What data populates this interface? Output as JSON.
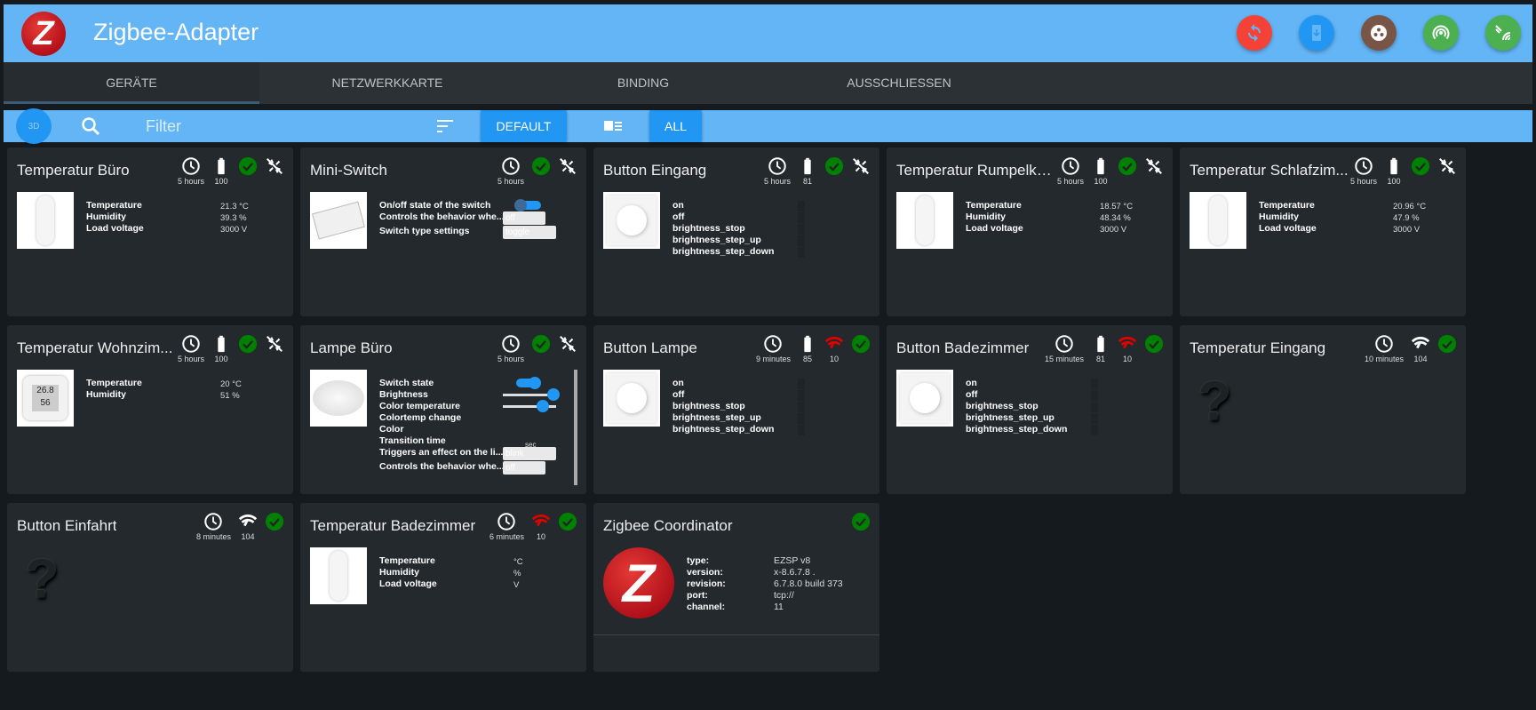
{
  "header": {
    "title": "Zigbee-Adapter",
    "logo_text": "Z",
    "buttons": [
      {
        "name": "refresh-button",
        "icon": "refresh-icon",
        "color": "#f44336"
      },
      {
        "name": "install-button",
        "icon": "phone-download-icon",
        "color": "#2196f3"
      },
      {
        "name": "groups-button",
        "icon": "group-icon",
        "color": "#795548"
      },
      {
        "name": "pairing-button",
        "icon": "pairing-icon",
        "color": "#4caf50"
      },
      {
        "name": "touchlink-button",
        "icon": "touchlink-icon",
        "color": "#4caf50"
      }
    ]
  },
  "tabs": [
    {
      "label": "GERÄTE",
      "active": true
    },
    {
      "label": "NETZWERKKARTE"
    },
    {
      "label": "BINDING"
    },
    {
      "label": "AUSSCHLIESSEN"
    }
  ],
  "toolbar": {
    "btn3d": "3D",
    "filter_placeholder": "Filter",
    "default_label": "DEFAULT",
    "all_label": "ALL"
  },
  "cards": [
    {
      "title": "Temperatur Büro",
      "time": "5 hours",
      "battery": "100",
      "link_off": true,
      "img": "sensor",
      "rows": [
        "Temperature",
        "Humidity",
        "Load voltage"
      ],
      "values": [
        "21.3 °C",
        "39.3 %",
        "3000 V"
      ]
    },
    {
      "title": "Mini-Switch",
      "time": "5 hours",
      "link_off": true,
      "img": "switch",
      "controls": [
        {
          "label": "On/off state of the switch",
          "type": "toggle"
        },
        {
          "label": "Controls the behavior whe...",
          "type": "select",
          "value": "off"
        },
        {
          "label": "Switch type settings",
          "type": "select",
          "value": "toggle"
        }
      ]
    },
    {
      "title": "Button Eingang",
      "time": "5 hours",
      "battery": "81",
      "link_off": true,
      "img": "button",
      "rows": [
        "on",
        "off",
        "brightness_stop",
        "brightness_step_up",
        "brightness_step_down"
      ],
      "states": true
    },
    {
      "title": "Temperatur Rumpelka...",
      "time": "5 hours",
      "battery": "100",
      "link_off": true,
      "img": "sensor",
      "rows": [
        "Temperature",
        "Humidity",
        "Load voltage"
      ],
      "values": [
        "18.57 °C",
        "48.34 %",
        "3000 V"
      ]
    },
    {
      "title": "Temperatur Schlafzim...",
      "time": "5 hours",
      "battery": "100",
      "link_off": true,
      "img": "sensor",
      "rows": [
        "Temperature",
        "Humidity",
        "Load voltage"
      ],
      "values": [
        "20.96 °C",
        "47.9 %",
        "3000 V"
      ]
    },
    {
      "title": "Temperatur Wohnzim...",
      "time": "5 hours",
      "battery": "100",
      "link_off": true,
      "img": "lcd",
      "lcd": [
        "26.8",
        "56"
      ],
      "rows": [
        "Temperature",
        "Humidity"
      ],
      "values": [
        "20 °C",
        "51 %"
      ]
    },
    {
      "title": "Lampe Büro",
      "time": "5 hours",
      "link_off": true,
      "img": "lamp",
      "controls": [
        {
          "label": "Switch state",
          "type": "toggle"
        },
        {
          "label": "Brightness",
          "type": "slider",
          "value": 0.95
        },
        {
          "label": "Color temperature",
          "type": "slider",
          "value": 0.75
        },
        {
          "label": "Colortemp change",
          "type": "none"
        },
        {
          "label": "Color",
          "type": "none"
        },
        {
          "label": "Transition time",
          "type": "unit",
          "value": "sec"
        },
        {
          "label": "Triggers an effect on the li...",
          "type": "input",
          "value": "blink"
        },
        {
          "label": "Controls the behavior whe...",
          "type": "select",
          "value": "off"
        }
      ]
    },
    {
      "title": "Button Lampe",
      "time": "9 minutes",
      "battery": "85",
      "signal": "10",
      "signal_bad": true,
      "img": "button",
      "rows": [
        "on",
        "off",
        "brightness_stop",
        "brightness_step_up",
        "brightness_step_down"
      ],
      "states": true
    },
    {
      "title": "Button Badezimmer",
      "time": "15 minutes",
      "battery": "81",
      "signal": "10",
      "signal_bad": true,
      "img": "button",
      "rows": [
        "on",
        "off",
        "brightness_stop",
        "brightness_step_up",
        "brightness_step_down"
      ],
      "states": true
    },
    {
      "title": "Temperatur Eingang",
      "time": "10 minutes",
      "signal": "104",
      "img": "unknown",
      "question": "?"
    },
    {
      "title": "Button Einfahrt",
      "time": "8 minutes",
      "signal": "104",
      "img": "unknown",
      "question": "?"
    },
    {
      "title": "Temperatur Badezimmer",
      "time": "6 minutes",
      "signal": "10",
      "signal_bad": true,
      "img": "sensor",
      "rows": [
        "Temperature",
        "Humidity",
        "Load voltage"
      ],
      "values": [
        "°C",
        "%",
        "V"
      ]
    },
    {
      "title": "Zigbee Coordinator",
      "coordinator": true,
      "logo_text": "Z",
      "rows": [
        "type:",
        "version:",
        "revision:",
        "port:",
        "channel:"
      ],
      "values": [
        "EZSP v8",
        "x-8.6.7.8 .",
        "6.7.8.0 build 373",
        "tcp://",
        "11"
      ]
    }
  ],
  "colors": {
    "ok": "#008000",
    "bad": "#e00000"
  }
}
